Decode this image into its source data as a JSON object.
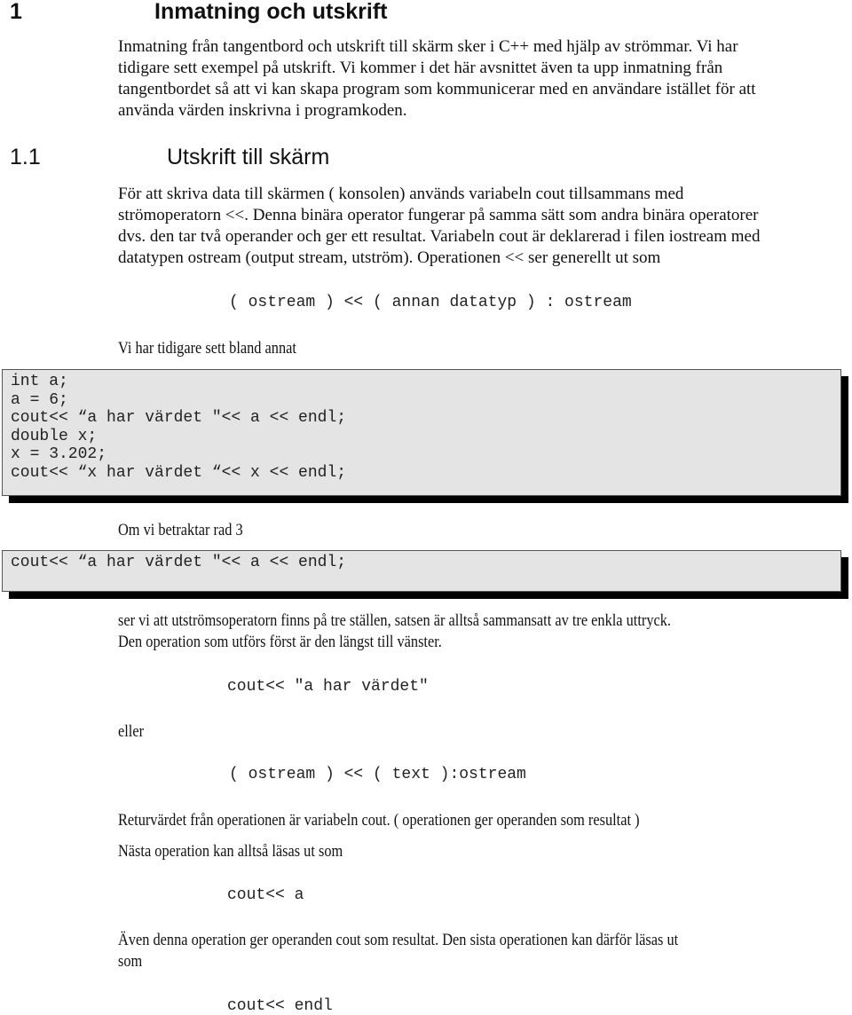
{
  "section1": {
    "number": "1",
    "title": "Inmatning och utskrift",
    "intro_lines": [
      "Inmatning från tangentbord och utskrift till skärm sker i C++ med hjälp av strömmar. Vi har",
      "tidigare sett exempel på utskrift. Vi kommer i det här avsnittet även ta upp inmatning från",
      "tangentbordet så att vi kan skapa program som kommunicerar med en användare istället för att",
      "använda värden inskrivna i programkoden."
    ]
  },
  "section1_1": {
    "number": "1.1",
    "title": "Utskrift till skärm",
    "para_lines": [
      "För att skriva data till skärmen ( konsolen) används variabeln cout tillsammans med",
      "strömoperatorn <<. Denna binära operator fungerar på samma sätt som andra binära operatorer",
      "dvs. den tar två operander och ger ett resultat. Variabeln cout är deklarerad i filen iostream med",
      "datatypen ostream (output stream, utström). Operationen << ser generellt ut som"
    ],
    "signature": "( ostream ) << ( annan datatyp ) : ostream",
    "seen_before": "Vi har tidigare sett bland annat",
    "code_block": [
      "int a;",
      "a = 6;",
      "cout<< “a har värdet \"<< a << endl;",
      "double x;",
      "x = 3.202;",
      "cout<< “x har värdet “<< x << endl;"
    ],
    "consider_row": "Om vi betraktar rad 3",
    "code_line3": "cout<< “a har värdet \"<< a << endl;",
    "explain_lines": [
      "ser vi att utströmsoperatorn finns på tre ställen, satsen är alltså sammansatt av tre enkla uttryck.",
      "Den operation som utförs först är den längst till vänster."
    ],
    "expr1": "cout<< \"a har värdet\"",
    "or_label": "eller",
    "expr2": "( ostream ) << ( text ):ostream",
    "return_text": "Returvärdet från operationen är variabeln cout. ( operationen ger operanden som resultat )",
    "next_text": "Nästa operation kan alltså läsas ut som",
    "expr3": "cout<< a",
    "also_lines": [
      "Även denna operation ger operanden cout som resultat. Den sista operationen kan därför läsas ut",
      "som"
    ],
    "expr4": "cout<< endl"
  }
}
